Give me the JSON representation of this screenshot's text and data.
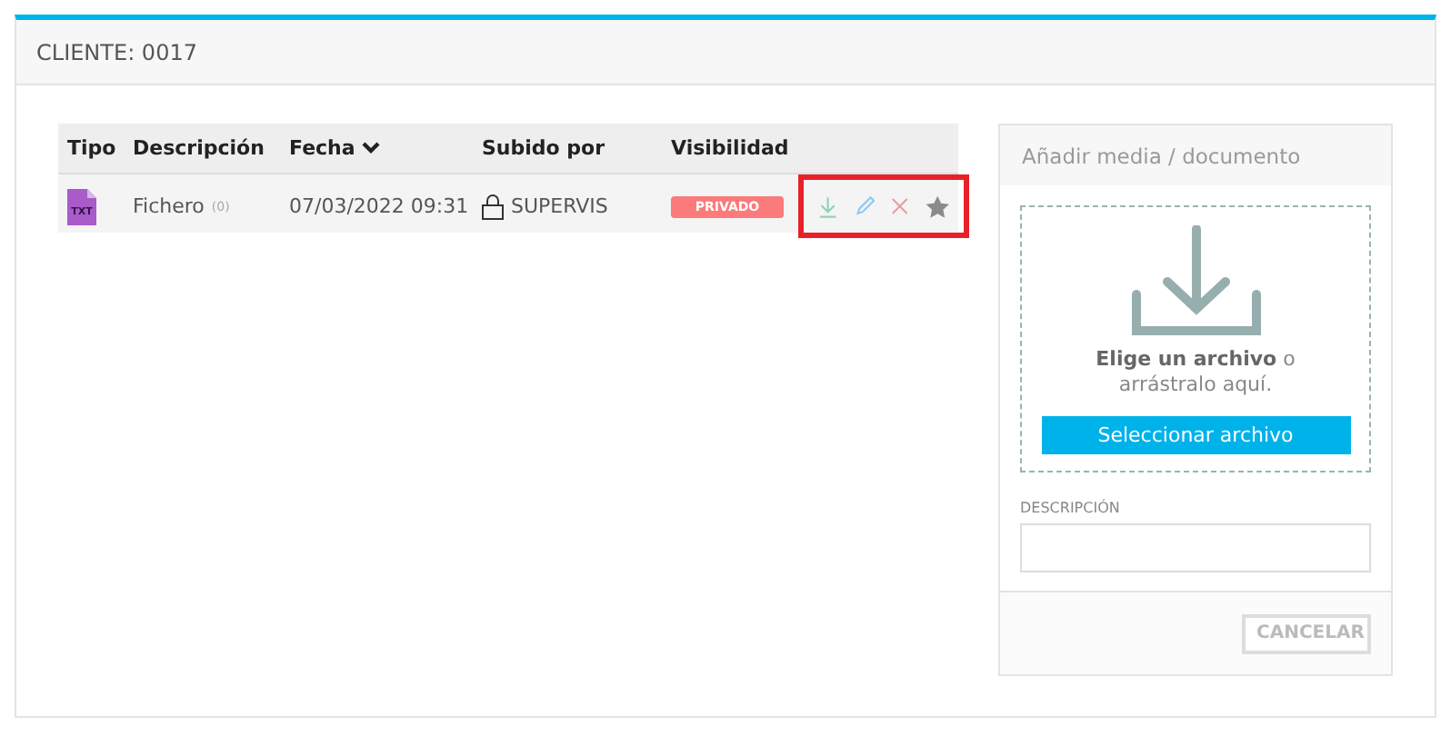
{
  "header": {
    "title": "CLIENTE: 0017"
  },
  "table": {
    "columns": [
      {
        "label": "Tipo",
        "sorted": false
      },
      {
        "label": "Descripción",
        "sorted": false
      },
      {
        "label": "Fecha",
        "sorted": true
      },
      {
        "label": "Subido por",
        "sorted": false
      },
      {
        "label": "Visibilidad",
        "sorted": false
      }
    ],
    "rows": [
      {
        "type_badge": "TXT",
        "description": "Fichero",
        "count": "(0)",
        "date": "07/03/2022 09:31",
        "uploaded_by": "SUPERVIS",
        "locked": true,
        "visibility": "PRIVADO",
        "actions_highlighted": true
      }
    ]
  },
  "upload": {
    "title": "Añadir media / documento",
    "prompt": "**Elige un archivo** o arrástralo aquí.",
    "select_button": "Seleccionar archivo",
    "description_label": "DESCRIPCIÓN",
    "cancel_button": "CANCELAR"
  }
}
